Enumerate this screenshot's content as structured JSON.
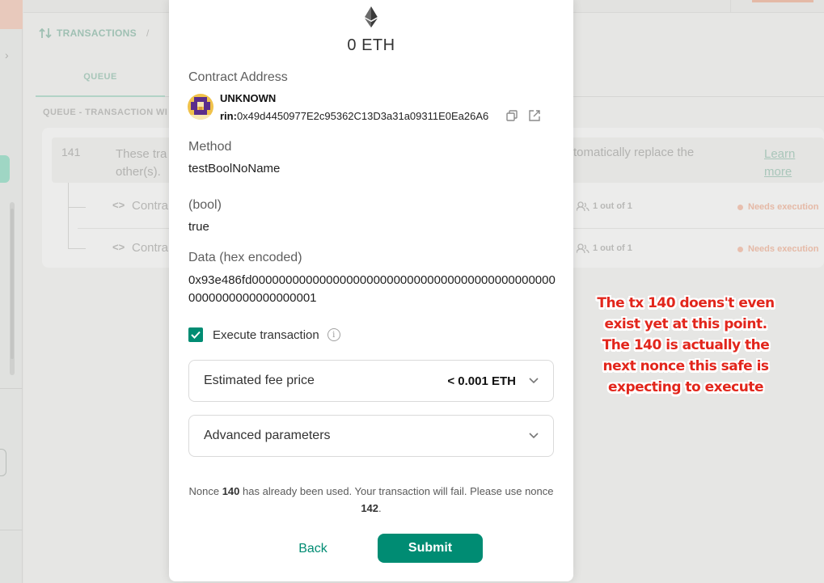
{
  "background": {
    "breadcrumb": {
      "label": "TRANSACTIONS",
      "separator": "/"
    },
    "tabs": [
      {
        "label": "QUEUE"
      }
    ],
    "queue_section_label": "QUEUE - TRANSACTION WI",
    "tx": {
      "nonce": "141",
      "description_left": "These tra other(s).",
      "description_right": "tomatically replace the",
      "learn_more": "Learn more",
      "items": [
        {
          "icon": "<>",
          "label": "Contra",
          "confirmations": "1 out of 1",
          "status": "Needs execution"
        },
        {
          "icon": "<>",
          "label": "Contra",
          "confirmations": "1 out of 1",
          "status": "Needs execution"
        }
      ]
    },
    "colors": {
      "accent": "#008c73",
      "status": "#e8bfae"
    }
  },
  "modal": {
    "amount": "0 ETH",
    "contract_address": {
      "label": "Contract Address",
      "name": "UNKNOWN",
      "prefix": "rin:",
      "address": "0x49d4450977E2c95362C13D3a31a09311E0Ea26A6"
    },
    "method": {
      "label": "Method",
      "value": "testBoolNoName"
    },
    "param": {
      "label": "(bool)",
      "value": "true"
    },
    "data": {
      "label": "Data (hex encoded)",
      "value": "0x93e486fd0000000000000000000000000000000000000000000000000000000000000001"
    },
    "execute": {
      "label": "Execute transaction",
      "checked": true
    },
    "fee": {
      "label": "Estimated fee price",
      "value": "< 0.001 ETH"
    },
    "advanced": {
      "label": "Advanced parameters"
    },
    "warning": {
      "part1": "Nonce ",
      "used_nonce": "140",
      "part2": " has already been used. Your transaction will fail. Please use nonce ",
      "suggested_nonce": "142",
      "part3": "."
    },
    "buttons": {
      "back": "Back",
      "submit": "Submit"
    }
  },
  "annotation": {
    "text": "The tx 140 doens't even exist yet at this point. The 140 is actually the next nonce this safe is expecting to execute"
  }
}
